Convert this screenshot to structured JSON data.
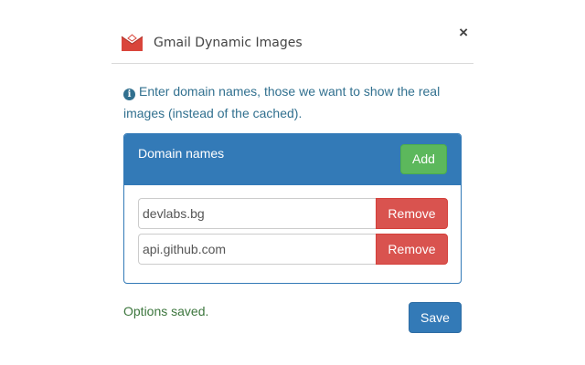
{
  "app": {
    "title": "Gmail Dynamic Images",
    "icon": "gmail-envelope-icon",
    "close_label": "×"
  },
  "info": {
    "icon": "info-circle-icon",
    "text": "Enter domain names, those we want to show the real images (instead of the cached)."
  },
  "panel": {
    "title": "Domain names",
    "add_label": "Add",
    "rows": [
      {
        "value": "devlabs.bg",
        "remove_label": "Remove"
      },
      {
        "value": "api.github.com",
        "remove_label": "Remove"
      }
    ]
  },
  "footer": {
    "status": "Options saved.",
    "save_label": "Save"
  },
  "colors": {
    "primary": "#337ab7",
    "success": "#5cb85c",
    "danger": "#d9534f",
    "info": "#31708f",
    "status": "#3c763d"
  }
}
